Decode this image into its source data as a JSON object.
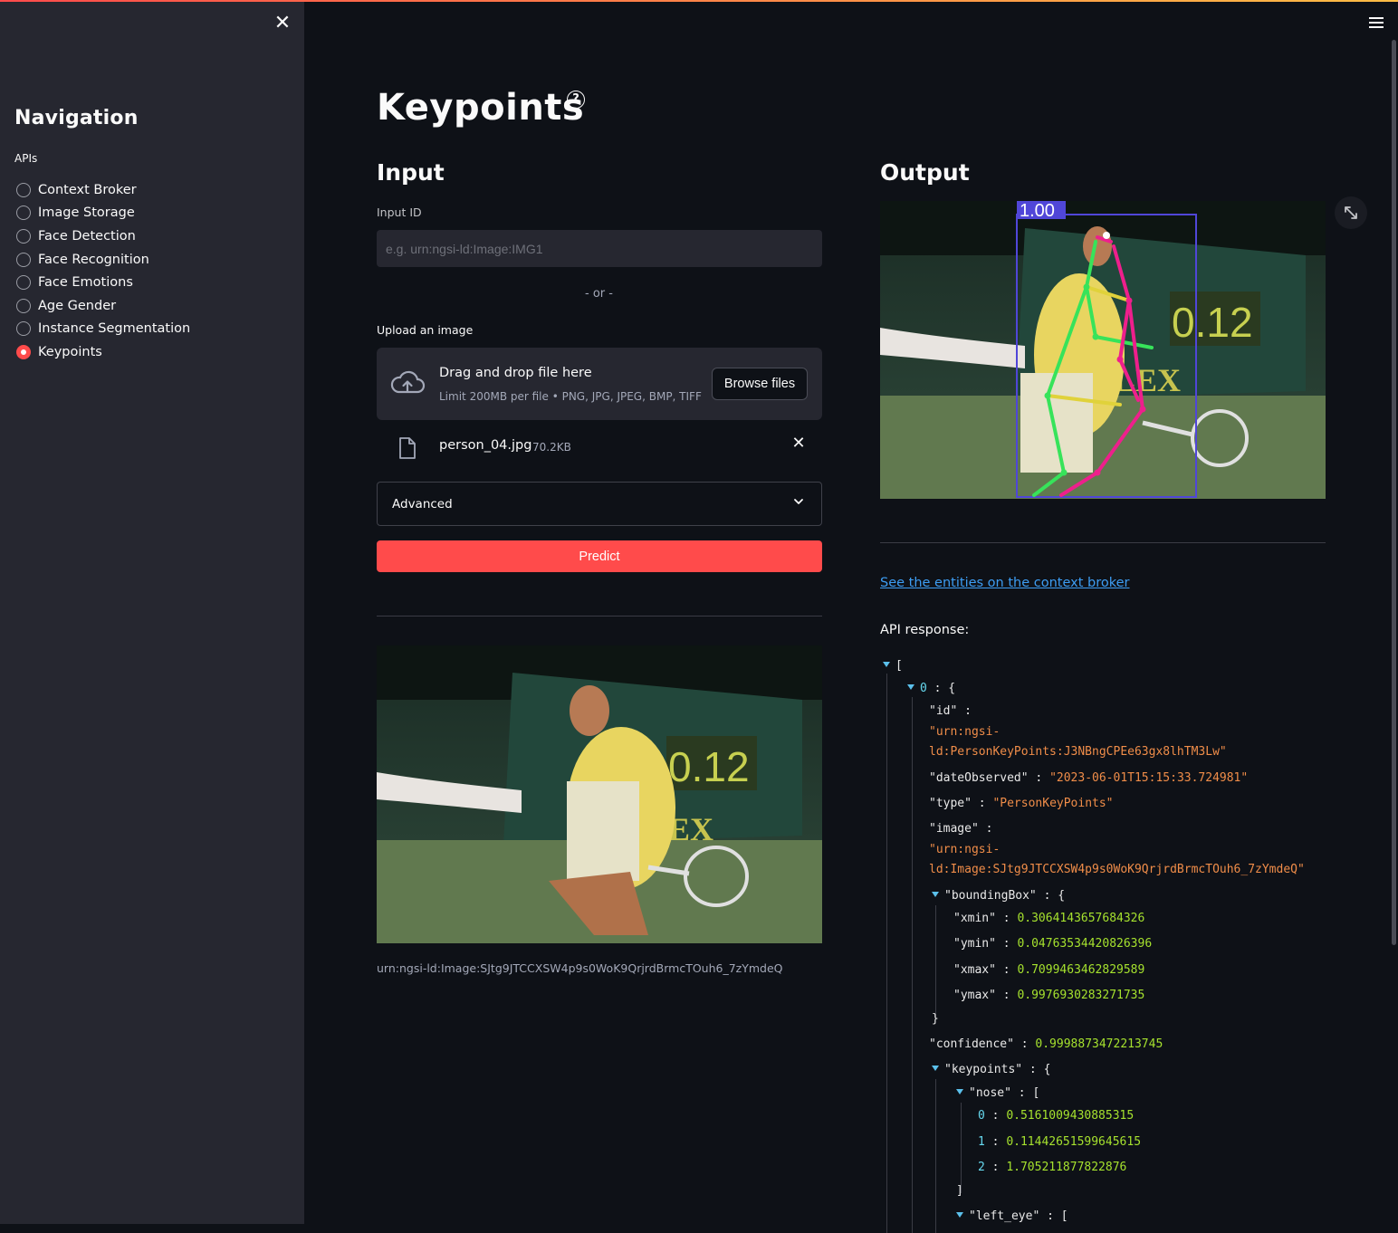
{
  "sidebar": {
    "title": "Navigation",
    "group_label": "APIs",
    "items": [
      {
        "label": "Context Broker",
        "selected": false
      },
      {
        "label": "Image Storage",
        "selected": false
      },
      {
        "label": "Face Detection",
        "selected": false
      },
      {
        "label": "Face Recognition",
        "selected": false
      },
      {
        "label": "Face Emotions",
        "selected": false
      },
      {
        "label": "Age Gender",
        "selected": false
      },
      {
        "label": "Instance Segmentation",
        "selected": false
      },
      {
        "label": "Keypoints",
        "selected": true
      }
    ]
  },
  "page": {
    "title": "Keypoints"
  },
  "input": {
    "heading": "Input",
    "input_id_label": "Input ID",
    "input_id_placeholder": "e.g. urn:ngsi-ld:Image:IMG1",
    "or_text": "- or -",
    "upload_label": "Upload an image",
    "dropzone_title": "Drag and drop file here",
    "dropzone_subtitle": "Limit 200MB per file • PNG, JPG, JPEG, BMP, TIFF",
    "browse_label": "Browse files",
    "file_name": "person_04.jpg",
    "file_size": "70.2KB",
    "advanced_label": "Advanced",
    "predict_label": "Predict",
    "image_caption": "urn:ngsi-ld:Image:SJtg9JTCCXSW4p9s0WoK9QrjrdBrmcTOuh6_7zYmdeQ"
  },
  "output": {
    "heading": "Output",
    "box_score": "1.00",
    "link_text": "See the entities on the context broker",
    "api_label": "API response:"
  },
  "json_view": {
    "open_bracket": "[",
    "item_index": "0",
    "id_key": "\"id\"",
    "id_val_1": "\"urn:ngsi-",
    "id_val_2": "ld:PersonKeyPoints:J3NBngCPEe63gx8lhTM3Lw\"",
    "date_key": "\"dateObserved\"",
    "date_val": "\"2023-06-01T15:15:33.724981\"",
    "type_key": "\"type\"",
    "type_val": "\"PersonKeyPoints\"",
    "image_key": "\"image\"",
    "image_val_1": "\"urn:ngsi-",
    "image_val_2": "ld:Image:SJtg9JTCCXSW4p9s0WoK9QrjrdBrmcTOuh6_7zYmdeQ\"",
    "bbox_key": "\"boundingBox\"",
    "xmin_key": "\"xmin\"",
    "xmin_val": "0.3064143657684326",
    "ymin_key": "\"ymin\"",
    "ymin_val": "0.04763534420826396",
    "xmax_key": "\"xmax\"",
    "xmax_val": "0.7099463462829589",
    "ymax_key": "\"ymax\"",
    "ymax_val": "0.9976930283271735",
    "close_brace": "}",
    "conf_key": "\"confidence\"",
    "conf_val": "0.9998873472213745",
    "kp_key": "\"keypoints\"",
    "nose_key": "\"nose\"",
    "nose_0": "0.5161009430885315",
    "nose_1": "0.11442651599645615",
    "nose_2": "1.705211877822876",
    "close_bracket": "]",
    "left_eye_key": "\"left_eye\""
  },
  "colors": {
    "accent": "#ff4b4b",
    "link": "#3d9df3",
    "json_string": "#f08d49",
    "json_number": "#a6e22e"
  }
}
